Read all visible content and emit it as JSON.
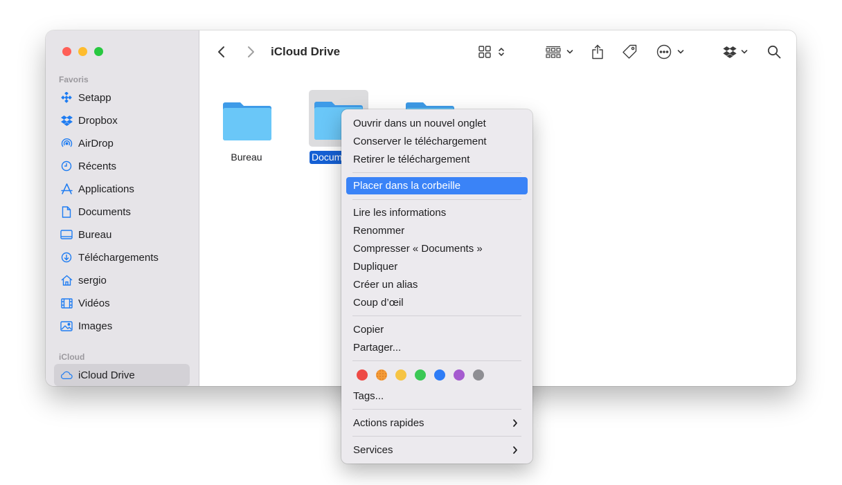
{
  "sidebar": {
    "favorites_label": "Favoris",
    "icloud_label": "iCloud",
    "items": [
      {
        "label": "Setapp",
        "icon": "setapp-icon"
      },
      {
        "label": "Dropbox",
        "icon": "dropbox-icon"
      },
      {
        "label": "AirDrop",
        "icon": "airdrop-icon"
      },
      {
        "label": "Récents",
        "icon": "clock-icon"
      },
      {
        "label": "Applications",
        "icon": "applications-icon"
      },
      {
        "label": "Documents",
        "icon": "document-icon"
      },
      {
        "label": "Bureau",
        "icon": "desktop-icon"
      },
      {
        "label": "Téléchargements",
        "icon": "download-icon"
      },
      {
        "label": "sergio",
        "icon": "home-icon"
      },
      {
        "label": "Vidéos",
        "icon": "film-icon"
      },
      {
        "label": "Images",
        "icon": "photo-icon"
      }
    ],
    "icloud_items": [
      {
        "label": "iCloud Drive",
        "icon": "cloud-icon",
        "active": true
      }
    ]
  },
  "toolbar": {
    "title": "iCloud Drive",
    "icons": [
      "back-arrow-icon",
      "forward-arrow-icon",
      "grid-view-icon",
      "group-icon",
      "share-icon",
      "tag-icon",
      "more-icon",
      "dropbox-icon",
      "search-icon"
    ]
  },
  "files": [
    {
      "name": "Bureau",
      "selected": false
    },
    {
      "name": "Documents",
      "display_name": "Docum",
      "selected": true
    },
    {
      "name": "",
      "selected": false
    }
  ],
  "context_menu": {
    "group1": [
      "Ouvrir dans un nouvel onglet",
      "Conserver le téléchargement",
      "Retirer le téléchargement"
    ],
    "highlighted": "Placer dans la corbeille",
    "group3": [
      "Lire les informations",
      "Renommer",
      "Compresser « Documents »",
      "Dupliquer",
      "Créer un alias",
      "Coup d’œil"
    ],
    "group4": [
      "Copier",
      "Partager..."
    ],
    "tag_colors": [
      "#ee4a45",
      "#f49b37",
      "#f6c443",
      "#3bc855",
      "#2e7cf6",
      "#a55bcf",
      "#8e8e93"
    ],
    "tags_label": "Tags...",
    "quick_actions": "Actions rapides",
    "services": "Services"
  },
  "colors": {
    "accent": "#3a83f7",
    "folder": "#63bdf6",
    "sidebar_bg": "#e6e4e8"
  }
}
